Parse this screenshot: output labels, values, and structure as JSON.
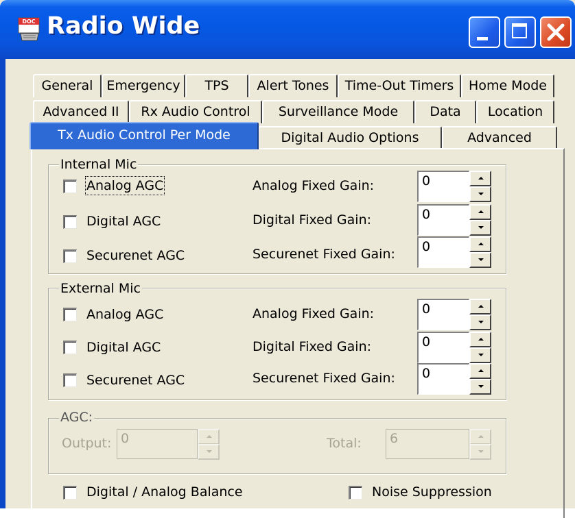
{
  "window": {
    "title": "Radio Wide",
    "icon": "doc-icon",
    "icon_text": "DOC",
    "colors": {
      "titlebar": "#0558e3",
      "active_tab": "#2e6ad6",
      "close_button": "#dc4a24",
      "face": "#ece9d8"
    }
  },
  "tabs": {
    "row1": [
      "General",
      "Emergency",
      "TPS",
      "Alert Tones",
      "Time-Out Timers",
      "Home Mode"
    ],
    "row2": [
      "Advanced II",
      "Rx Audio Control",
      "Surveillance Mode",
      "Data",
      "Location"
    ],
    "row3": [
      "Tx Audio Control Per Mode",
      "Digital Audio Options",
      "Advanced"
    ],
    "active": "Tx Audio Control Per Mode"
  },
  "internal_mic": {
    "title": "Internal Mic",
    "rows": [
      {
        "checkbox": "Analog AGC",
        "checked": false,
        "gain_label": "Analog Fixed Gain:",
        "value": "0"
      },
      {
        "checkbox": "Digital AGC",
        "checked": false,
        "gain_label": "Digital Fixed Gain:",
        "value": "0"
      },
      {
        "checkbox": "Securenet AGC",
        "checked": false,
        "gain_label": "Securenet Fixed Gain:",
        "value": "0"
      }
    ]
  },
  "external_mic": {
    "title": "External Mic",
    "rows": [
      {
        "checkbox": "Analog AGC",
        "checked": false,
        "gain_label": "Analog Fixed Gain:",
        "value": "0"
      },
      {
        "checkbox": "Digital AGC",
        "checked": false,
        "gain_label": "Digital Fixed Gain:",
        "value": "0"
      },
      {
        "checkbox": "Securenet AGC",
        "checked": false,
        "gain_label": "Securenet Fixed Gain:",
        "value": "0"
      }
    ]
  },
  "agc": {
    "title": "AGC:",
    "output_label": "Output:",
    "output_value": "0",
    "total_label": "Total:",
    "total_value": "6"
  },
  "bottom": {
    "balance_label": "Digital / Analog Balance",
    "noise_label": "Noise Suppression"
  }
}
